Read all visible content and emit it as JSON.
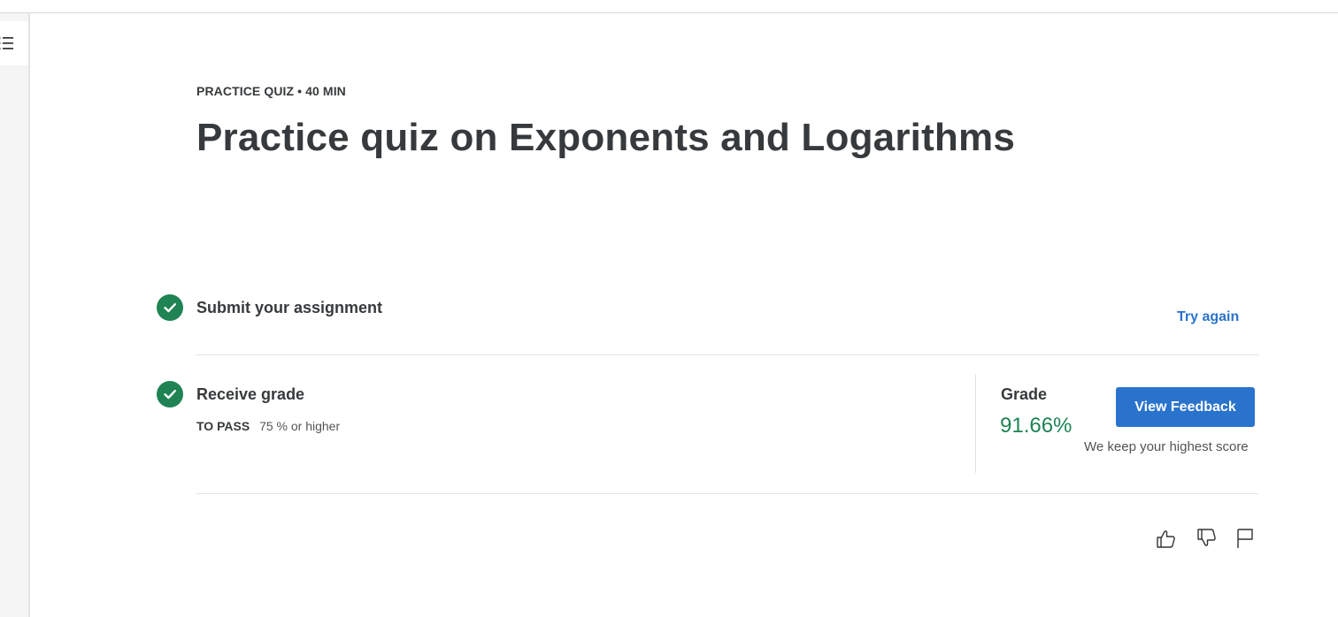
{
  "header": {
    "eyebrow": "PRACTICE QUIZ • 40 MIN",
    "title": "Practice quiz on Exponents and Logarithms"
  },
  "steps": [
    {
      "title": "Submit your assignment",
      "status": "complete",
      "action_label": "Try again"
    },
    {
      "title": "Receive grade",
      "status": "complete",
      "pass_label": "TO PASS",
      "pass_value": "75 % or higher"
    }
  ],
  "grade": {
    "label": "Grade",
    "value": "91.66%",
    "button_label": "View Feedback",
    "note": "We keep your highest score"
  },
  "reaction_icons": [
    "thumbs-up-icon",
    "thumbs-down-icon",
    "flag-icon"
  ],
  "colors": {
    "accent": "#2a73cc",
    "success": "#1f8354",
    "text": "#373a3c"
  }
}
